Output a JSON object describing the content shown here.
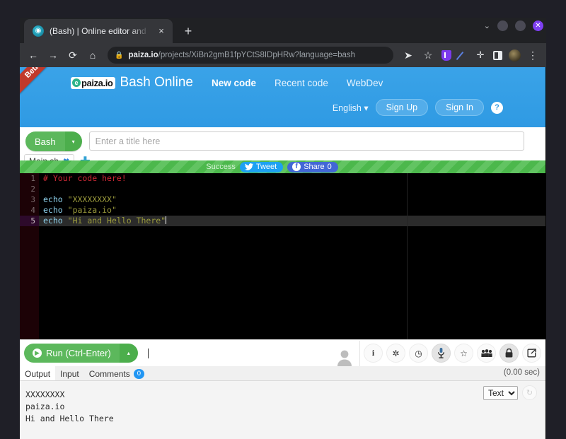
{
  "browser": {
    "tab": {
      "title": "(Bash) | Online editor and",
      "favicon": "paiza-favicon-icon",
      "close": "×"
    },
    "newtab": "+",
    "window_controls": {
      "minimize_chevron": "⌄",
      "close": "✕"
    },
    "nav": {
      "back": "←",
      "forward": "→",
      "reload": "⟳",
      "home": "⌂"
    },
    "omnibox": {
      "lock": "🔒",
      "url_domain": "paiza.io",
      "url_path": "/projects/XiBn2gmB1fpYCtS8IDpHRw?language=bash"
    },
    "actions": {
      "send": "➤",
      "bookmark": "☆",
      "menu": "⋮"
    },
    "extensions": [
      "shield-icon",
      "pen-icon",
      "puzzle-icon",
      "panel-icon",
      "profile-avatar"
    ]
  },
  "site": {
    "ribbon": "Beta",
    "logo_mark": "e",
    "logo_text": "paiza.io",
    "title": "Bash Online",
    "nav": [
      {
        "label": "New code",
        "active": true
      },
      {
        "label": "Recent code",
        "active": false
      },
      {
        "label": "WebDev",
        "active": false
      }
    ],
    "language_selector": "English",
    "language_caret": "▾",
    "sign_up": "Sign Up",
    "sign_in": "Sign In",
    "help": "?"
  },
  "editor_head": {
    "language": "Bash",
    "language_caret": "▾",
    "title_placeholder": "Enter a title here",
    "title_value": "",
    "file_tabs": [
      {
        "name": "Main.sh",
        "close": "✖"
      }
    ],
    "add_file": "✚"
  },
  "stripe": {
    "status": "Success",
    "tweet": "Tweet",
    "tweet_icon": "twitter-bird-icon",
    "share": "Share",
    "share_count": "0",
    "share_icon": "f"
  },
  "code": {
    "lines": [
      {
        "n": "1",
        "current": false,
        "tokens": [
          {
            "t": "cmt",
            "s": "# Your code here!"
          }
        ]
      },
      {
        "n": "2",
        "current": false,
        "tokens": []
      },
      {
        "n": "3",
        "current": false,
        "tokens": [
          {
            "t": "kw",
            "s": "echo"
          },
          {
            "t": "plain",
            "s": " "
          },
          {
            "t": "str",
            "s": "\"XXXXXXXX\""
          }
        ]
      },
      {
        "n": "4",
        "current": false,
        "tokens": [
          {
            "t": "kw",
            "s": "echo"
          },
          {
            "t": "plain",
            "s": " "
          },
          {
            "t": "str",
            "s": "\"paiza.io\""
          }
        ]
      },
      {
        "n": "5",
        "current": true,
        "tokens": [
          {
            "t": "kw",
            "s": "echo"
          },
          {
            "t": "plain",
            "s": " "
          },
          {
            "t": "str",
            "s": "\"Hi and Hello There\""
          }
        ]
      }
    ]
  },
  "runbar": {
    "run_label": "Run (Ctrl-Enter)",
    "run_play_icon": "play-icon",
    "run_caret": "▴",
    "icons": [
      {
        "name": "avatar-icon",
        "glyph": "\u0000",
        "on": false
      },
      {
        "name": "info-icon",
        "glyph": "i",
        "on": false
      },
      {
        "name": "gear-icon",
        "glyph": "✻",
        "on": false
      },
      {
        "name": "clock-icon",
        "glyph": "◴",
        "on": false
      },
      {
        "name": "microphone-icon",
        "glyph": "♟",
        "on": true
      },
      {
        "name": "star-icon",
        "glyph": "☆",
        "on": false
      },
      {
        "name": "users-icon",
        "glyph": "👥",
        "on": false
      },
      {
        "name": "lock-icon",
        "glyph": "🔒",
        "on": true
      },
      {
        "name": "share-export-icon",
        "glyph": "↪",
        "on": false
      }
    ]
  },
  "output": {
    "tabs": [
      {
        "label": "Output",
        "active": true
      },
      {
        "label": "Input",
        "active": false
      },
      {
        "label": "Comments",
        "active": false,
        "badge": "0"
      }
    ],
    "elapsed": "(0.00 sec)",
    "lines": [
      "XXXXXXXX",
      "paiza.io",
      "Hi and Hello There"
    ],
    "format_select": "Text",
    "format_caret": "▾",
    "refresh_icon": "↻"
  },
  "colors": {
    "brand_blue": "#3aa3e8",
    "accent_green": "#5cb85c",
    "stripe_green": "#4cb84c",
    "comment_red": "#cc2936",
    "keyword_blue": "#8fd4ef",
    "string_olive": "#9b9b3c",
    "twitter_blue": "#1da1f2",
    "facebook_blue": "#4267d6",
    "badge_blue": "#2196f3"
  }
}
